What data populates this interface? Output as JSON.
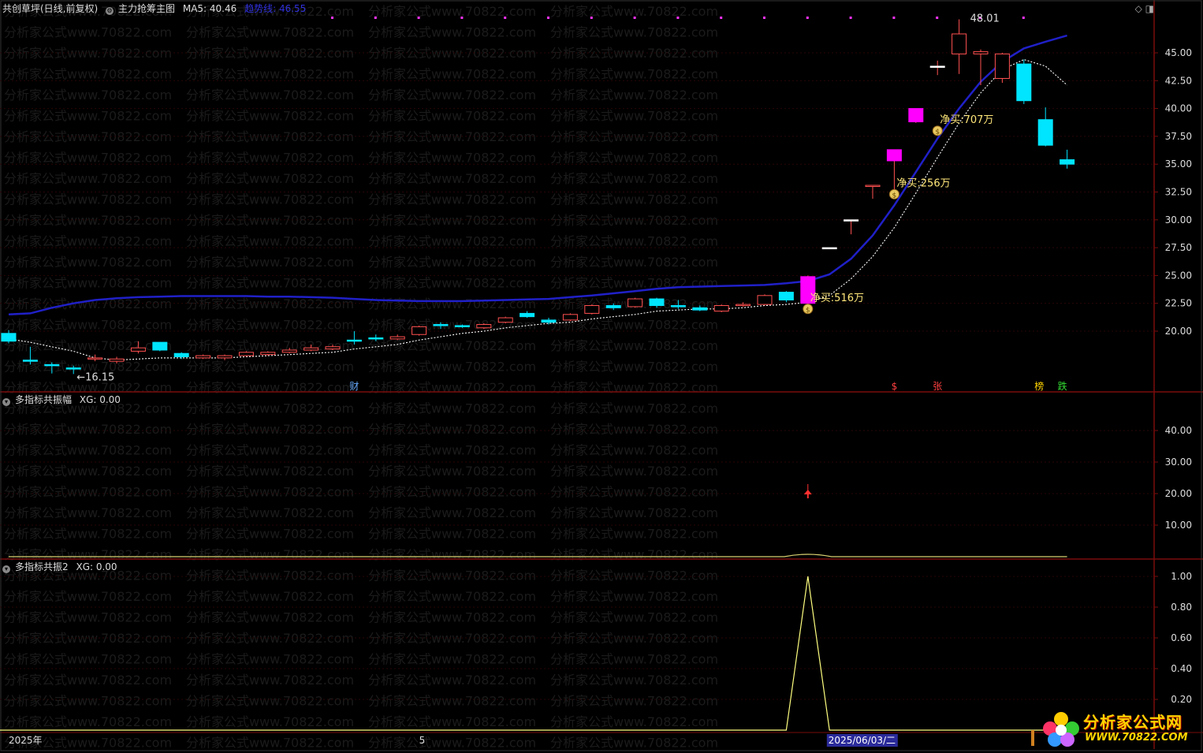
{
  "header": {
    "main": {
      "stock": "共创草坪(日线,前复权)",
      "indicator": "主力抢筹主图",
      "ma5_label": "MA5: 40.46",
      "trend_label": "趋势线: 46.55"
    },
    "panel2": {
      "title": "多指标共振幅",
      "xg": "XG: 0.00"
    },
    "panel3": {
      "title": "多指标共振2",
      "xg": "XG: 0.00"
    }
  },
  "colors": {
    "up": "#ff5050",
    "down": "#00e5ff",
    "up_fill": "#ff00ff",
    "trend": "#2020c8",
    "ma": "#ffffff",
    "axis": "#7a0c0c",
    "grid": "#2a0606",
    "label": "#ffe77a",
    "oscillator": "#d8d070"
  },
  "chart_data": [
    {
      "type": "candlestick",
      "ylim": [
        15,
        47
      ],
      "yticks": [
        "20.00",
        "22.50",
        "25.00",
        "27.50",
        "30.00",
        "32.50",
        "35.00",
        "37.50",
        "40.00",
        "42.50",
        "45.00"
      ],
      "candles": [
        {
          "o": 19.8,
          "c": 19.1,
          "h": 20.1,
          "l": 18.9
        },
        {
          "o": 17.4,
          "c": 17.3,
          "h": 18.6,
          "l": 17.0
        },
        {
          "o": 17.0,
          "c": 16.9,
          "h": 17.2,
          "l": 16.2
        },
        {
          "o": 16.7,
          "c": 16.6,
          "h": 16.9,
          "l": 16.15
        },
        {
          "o": 17.5,
          "c": 17.6,
          "h": 17.9,
          "l": 17.3
        },
        {
          "o": 17.3,
          "c": 17.5,
          "h": 17.7,
          "l": 17.1
        },
        {
          "o": 18.2,
          "c": 18.5,
          "h": 19.1,
          "l": 18.0
        },
        {
          "o": 19.0,
          "c": 18.3,
          "h": 19.0,
          "l": 18.2
        },
        {
          "o": 18.0,
          "c": 17.7,
          "h": 18.1,
          "l": 17.5
        },
        {
          "o": 17.6,
          "c": 17.8,
          "h": 17.9,
          "l": 17.5
        },
        {
          "o": 17.6,
          "c": 17.8,
          "h": 17.9,
          "l": 17.4
        },
        {
          "o": 17.8,
          "c": 18.1,
          "h": 18.2,
          "l": 17.7
        },
        {
          "o": 17.9,
          "c": 18.1,
          "h": 18.2,
          "l": 17.8
        },
        {
          "o": 18.1,
          "c": 18.3,
          "h": 18.5,
          "l": 18.0
        },
        {
          "o": 18.3,
          "c": 18.5,
          "h": 18.8,
          "l": 18.2
        },
        {
          "o": 18.4,
          "c": 18.6,
          "h": 18.8,
          "l": 18.3
        },
        {
          "o": 19.2,
          "c": 19.1,
          "h": 20.0,
          "l": 18.8
        },
        {
          "o": 19.4,
          "c": 19.3,
          "h": 19.7,
          "l": 19.1
        },
        {
          "o": 19.3,
          "c": 19.5,
          "h": 19.7,
          "l": 19.2
        },
        {
          "o": 19.7,
          "c": 20.4,
          "h": 20.5,
          "l": 19.6
        },
        {
          "o": 20.6,
          "c": 20.5,
          "h": 20.8,
          "l": 20.2
        },
        {
          "o": 20.5,
          "c": 20.4,
          "h": 20.6,
          "l": 20.3
        },
        {
          "o": 20.3,
          "c": 20.6,
          "h": 20.7,
          "l": 20.2
        },
        {
          "o": 20.8,
          "c": 21.2,
          "h": 21.3,
          "l": 20.7
        },
        {
          "o": 21.6,
          "c": 21.3,
          "h": 21.8,
          "l": 21.2
        },
        {
          "o": 21.0,
          "c": 20.8,
          "h": 21.2,
          "l": 20.6
        },
        {
          "o": 21.0,
          "c": 21.5,
          "h": 21.6,
          "l": 20.9
        },
        {
          "o": 21.6,
          "c": 22.3,
          "h": 22.4,
          "l": 21.5
        },
        {
          "o": 22.3,
          "c": 22.1,
          "h": 22.5,
          "l": 21.9
        },
        {
          "o": 22.2,
          "c": 22.9,
          "h": 23.0,
          "l": 22.1
        },
        {
          "o": 22.9,
          "c": 22.3,
          "h": 23.0,
          "l": 22.1
        },
        {
          "o": 22.3,
          "c": 22.2,
          "h": 22.8,
          "l": 22.0
        },
        {
          "o": 22.1,
          "c": 21.9,
          "h": 22.3,
          "l": 21.8
        },
        {
          "o": 21.8,
          "c": 22.3,
          "h": 22.4,
          "l": 21.7
        },
        {
          "o": 22.3,
          "c": 22.4,
          "h": 22.6,
          "l": 22.2
        },
        {
          "o": 22.4,
          "c": 23.2,
          "h": 23.3,
          "l": 22.3
        },
        {
          "o": 23.5,
          "c": 22.8,
          "h": 23.6,
          "l": 22.6
        },
        {
          "o": 22.5,
          "c": 24.9,
          "h": 25.0,
          "l": 22.4
        },
        {
          "o": 27.5,
          "c": 27.5,
          "h": 27.5,
          "l": 27.5
        },
        {
          "o": 30.0,
          "c": 30.0,
          "h": 30.0,
          "l": 28.7
        },
        {
          "o": 33.0,
          "c": 33.1,
          "h": 33.1,
          "l": 31.9
        },
        {
          "o": 35.3,
          "c": 36.3,
          "h": 36.3,
          "l": 32.0
        },
        {
          "o": 38.8,
          "c": 40.0,
          "h": 40.0,
          "l": 38.7
        },
        {
          "o": 43.8,
          "c": 43.8,
          "h": 44.3,
          "l": 43.0
        },
        {
          "o": 44.9,
          "c": 46.7,
          "h": 48.01,
          "l": 43.1
        },
        {
          "o": 44.9,
          "c": 45.1,
          "h": 45.3,
          "l": 42.1
        },
        {
          "o": 42.7,
          "c": 44.9,
          "h": 45.0,
          "l": 42.3
        },
        {
          "o": 44.0,
          "c": 40.7,
          "h": 44.4,
          "l": 40.4
        },
        {
          "o": 39.0,
          "c": 36.7,
          "h": 40.1,
          "l": 36.6
        },
        {
          "o": 35.4,
          "c": 35.0,
          "h": 36.3,
          "l": 34.6
        }
      ],
      "ma": [
        19.3,
        19.0,
        18.6,
        18.2,
        17.6,
        17.4,
        17.5,
        17.6,
        17.6,
        17.6,
        17.6,
        17.7,
        17.8,
        17.9,
        18.0,
        18.1,
        18.4,
        18.6,
        18.8,
        19.2,
        19.5,
        19.8,
        20.0,
        20.3,
        20.5,
        20.7,
        20.8,
        21.1,
        21.3,
        21.5,
        21.8,
        21.9,
        22.0,
        22.0,
        22.1,
        22.3,
        22.4,
        22.6,
        23.2,
        24.7,
        26.7,
        29.3,
        32.4,
        35.6,
        38.7,
        41.4,
        43.5,
        44.4,
        43.8,
        42.1
      ],
      "trend": [
        21.5,
        21.6,
        22.1,
        22.5,
        22.8,
        22.95,
        23.05,
        23.1,
        23.15,
        23.15,
        23.15,
        23.15,
        23.1,
        23.1,
        23.05,
        23.0,
        22.9,
        22.8,
        22.75,
        22.7,
        22.7,
        22.7,
        22.75,
        22.8,
        22.85,
        22.9,
        23.05,
        23.2,
        23.4,
        23.6,
        23.8,
        23.95,
        24.0,
        24.05,
        24.1,
        24.15,
        24.3,
        24.5,
        25.1,
        26.5,
        28.6,
        31.3,
        34.3,
        37.3,
        40.0,
        42.4,
        44.2,
        45.4,
        46.0,
        46.55
      ],
      "markers": [
        {
          "index": 3,
          "text": "←16.15",
          "price": 16.15
        },
        {
          "index": 44,
          "text": "48.01",
          "price": 48.01
        }
      ],
      "buy_labels": [
        {
          "index": 37,
          "price": 22.0,
          "text": "净买:516万"
        },
        {
          "index": 41,
          "price": 32.3,
          "text": "净买:256万"
        },
        {
          "index": 43,
          "price": 38.0,
          "text": "净买:707万"
        }
      ],
      "bottom_tags": [
        {
          "index": 16,
          "text": "财",
          "color": "#66aaff"
        },
        {
          "index": 41,
          "text": "$",
          "color": "#ff4040"
        },
        {
          "index": 43,
          "text": "张",
          "color": "#ff4040"
        },
        {
          "index": 48,
          "text": "榜",
          "color": "#ffd400"
        },
        {
          "index": 49,
          "text": "跌",
          "color": "#33dd33"
        }
      ]
    },
    {
      "type": "line",
      "ylim": [
        0,
        50
      ],
      "yticks": [
        "10.00",
        "20.00",
        "30.00",
        "40.00"
      ],
      "signal": {
        "index": 37,
        "value": 20.0
      }
    },
    {
      "type": "line",
      "ylim": [
        0,
        1.05
      ],
      "yticks": [
        "0.20",
        "0.40",
        "0.60",
        "0.80",
        "1.00"
      ],
      "values": [
        0,
        0,
        0,
        0,
        0,
        0,
        0,
        0,
        0,
        0,
        0,
        0,
        0,
        0,
        0,
        0,
        0,
        0,
        0,
        0,
        0,
        0,
        0,
        0,
        0,
        0,
        0,
        0,
        0,
        0,
        0,
        0,
        0,
        0,
        0,
        0,
        0,
        1,
        0,
        0,
        0,
        0,
        0,
        0,
        0,
        0,
        0,
        0,
        0,
        0
      ]
    }
  ],
  "xaxis": {
    "year_label": "2025年",
    "month_label": "5",
    "month_index": 19,
    "cursor_label": "2025/06/03/二",
    "cursor_index": 37
  },
  "watermark": "分析家公式www.70822.com",
  "logo": {
    "cn": "分析家公式网",
    "url": "WWW.70822.COM"
  }
}
